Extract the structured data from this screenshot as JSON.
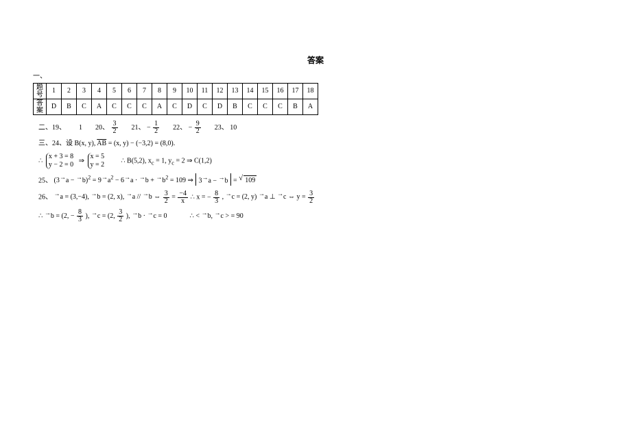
{
  "title": "答案",
  "section1_label": "一、",
  "table": {
    "row_label_q": "题号",
    "row_label_a": "答案",
    "numbers": [
      "1",
      "2",
      "3",
      "4",
      "5",
      "6",
      "7",
      "8",
      "9",
      "10",
      "11",
      "12",
      "13",
      "14",
      "15",
      "16",
      "17",
      "18"
    ],
    "answers": [
      "D",
      "B",
      "C",
      "A",
      "C",
      "C",
      "C",
      "A",
      "C",
      "D",
      "C",
      "D",
      "B",
      "C",
      "C",
      "C",
      "B",
      "A"
    ]
  },
  "section2": {
    "prefix": "二、19、",
    "a19": "1",
    "l20": "20、",
    "a20_num": "3",
    "a20_den": "2",
    "l21": "21、",
    "a21_sign": "−",
    "a21_num": "1",
    "a21_den": "2",
    "l22": "22、",
    "a22_sign": "−",
    "a22_num": "9",
    "a22_den": "2",
    "l23": "23、",
    "a23": "10"
  },
  "section3": {
    "prefix": "三、24、设 B(x, y),",
    "ab": "AB",
    "expr24": " = (x, y) − (−3,2) = (8,0).",
    "therefore": "∴",
    "sys1a": "x + 3 = 8",
    "sys1b": "y − 2 = 0",
    "imp": "⇒",
    "sys2a": "x = 5",
    "sys2b": "y = 2",
    "post24": "∴ B(5,2), x",
    "subc": "c",
    "eq1": " = 1, y",
    "eq2": " = 2 ⇒ C(1,2)"
  },
  "q25": {
    "label": "25、",
    "lhs": "(3a − b)² = 9a² − 6a · b + b² = 109 ⇒ ",
    "abs_in": "3a − b",
    "eq": " = ",
    "rad": "109"
  },
  "q26": {
    "label": "26、",
    "p1": "a = (3,−4), b = (2, x), a // b ⇔ ",
    "f1n": "3",
    "f1d": "2",
    "mid": " = ",
    "f2n": "−4",
    "f2d": "x",
    "p2": "   ∴ x = −",
    "f3n": "8",
    "f3d": "3",
    "p3": ",  c = (2, y) a ⊥ c ⇔ y = ",
    "f4n": "3",
    "f4d": "2",
    "line2a": "∴ b = (2, −",
    "l2_f1n": "8",
    "l2_f1d": "3",
    "line2b": "), c = (2, ",
    "l2_f2n": "3",
    "l2_f2d": "2",
    "line2c": "), b · c = 0",
    "line2d": "∴ < b, c > = 90"
  }
}
